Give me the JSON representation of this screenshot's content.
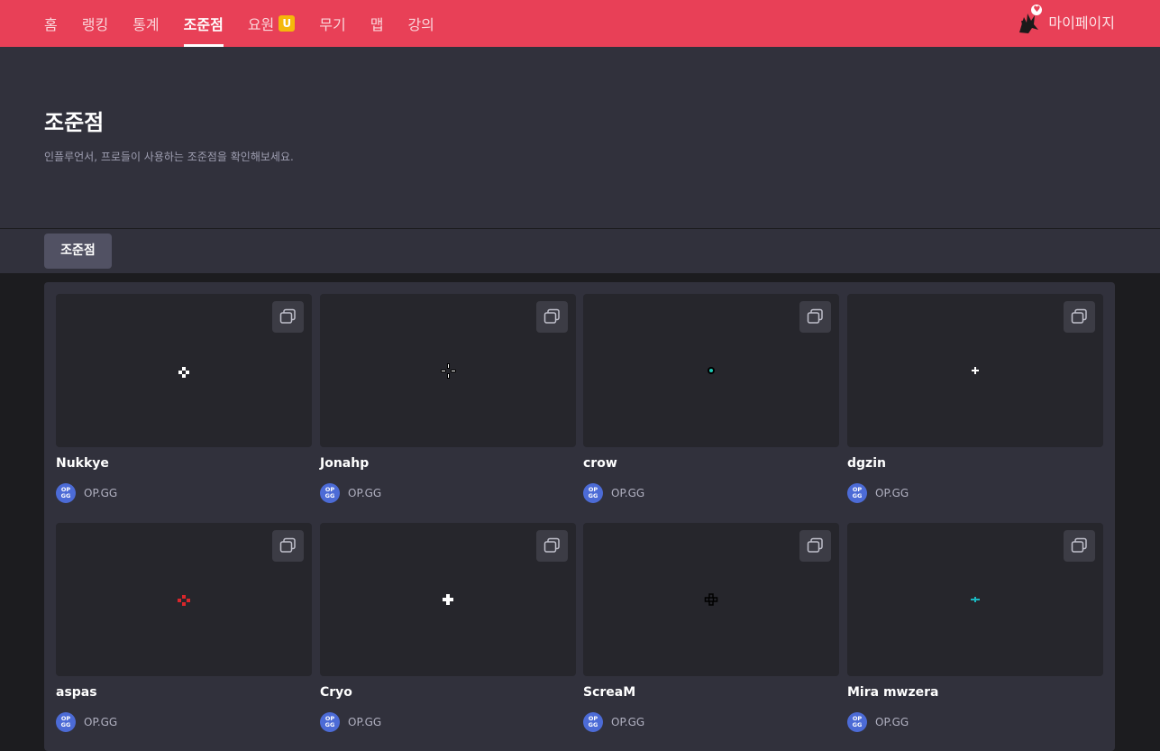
{
  "nav": {
    "items": [
      "홈",
      "랭킹",
      "통계",
      "조준점",
      "요원",
      "무기",
      "맵",
      "강의"
    ],
    "active": "조준점",
    "agent_badge": "U",
    "mypage_label": "마이페이지"
  },
  "hero": {
    "title": "조준점",
    "description": "인플루언서, 프로들이 사용하는 조준점을 확인해보세요."
  },
  "tabs": [
    "조준점"
  ],
  "source_logo_text": "OP\nGG",
  "colors": {
    "brand": "#e84057",
    "badge": "#f5b80b",
    "source_logo": "#4c6bd6"
  },
  "cards": [
    {
      "name": "Nukkye",
      "source": "OP.GG",
      "crosshair_style": "white-diamond-dots",
      "crosshair_color": "#ffffff"
    },
    {
      "name": "Jonahp",
      "source": "OP.GG",
      "crosshair_style": "outlined-cross-gap",
      "crosshair_color": "#ffffff"
    },
    {
      "name": "crow",
      "source": "OP.GG",
      "crosshair_style": "cyan-center-dot",
      "crosshair_color": "#1fc9b6"
    },
    {
      "name": "dgzin",
      "source": "OP.GG",
      "crosshair_style": "small-plus",
      "crosshair_color": "#ffffff"
    },
    {
      "name": "aspas",
      "source": "OP.GG",
      "crosshair_style": "red-diamond-dots",
      "crosshair_color": "#d9262b"
    },
    {
      "name": "Cryo",
      "source": "OP.GG",
      "crosshair_style": "bold-plus",
      "crosshair_color": "#ffffff"
    },
    {
      "name": "ScreaM",
      "source": "OP.GG",
      "crosshair_style": "black-diamond-rings",
      "crosshair_color": "#000000"
    },
    {
      "name": "Mira mwzera",
      "source": "OP.GG",
      "crosshair_style": "cyan-cross-dot",
      "crosshair_color": "#1ab7c0"
    }
  ]
}
